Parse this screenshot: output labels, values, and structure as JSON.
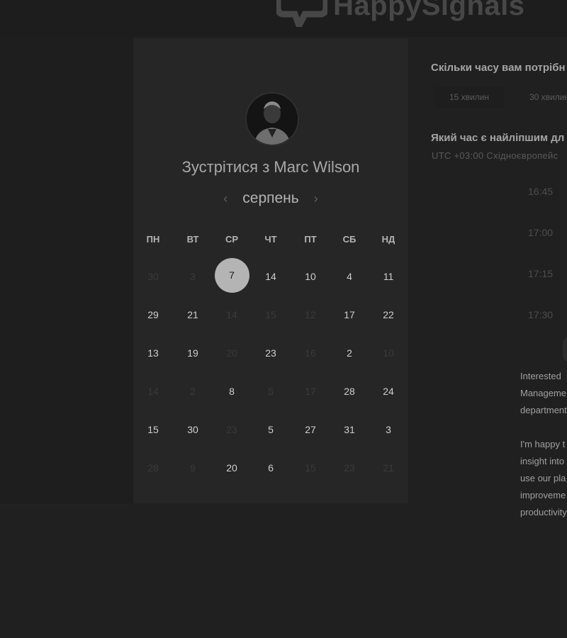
{
  "brand": {
    "name": "HappySignals",
    "logo_icon": "speech-bubble-check-icon"
  },
  "meeting": {
    "title": "Зустрітися з Marc Wilson",
    "avatar": "avatar-photo"
  },
  "calendar": {
    "month": "серпень",
    "prev_icon": "chevron-left-icon",
    "next_icon": "chevron-right-icon",
    "weekdays": [
      "ПН",
      "ВТ",
      "СР",
      "ЧТ",
      "ПТ",
      "СБ",
      "НД"
    ],
    "weeks": [
      [
        "30",
        "3",
        "7",
        "14",
        "10",
        "4",
        "11"
      ],
      [
        "29",
        "21",
        "14",
        "15",
        "12",
        "17",
        "22"
      ],
      [
        "13",
        "19",
        "20",
        "23",
        "16",
        "2",
        "10"
      ],
      [
        "14",
        "2",
        "8",
        "5",
        "17",
        "28",
        "24"
      ],
      [
        "15",
        "30",
        "23",
        "5",
        "27",
        "31",
        "3"
      ],
      [
        "28",
        "9",
        "20",
        "6",
        "15",
        "23",
        "21"
      ]
    ],
    "selected": "7"
  },
  "duration": {
    "question": "Скільки часу вам потрібн",
    "options": [
      "15 хвилин",
      "30 хвилин"
    ]
  },
  "time": {
    "question": "Який час є найліпшим дл",
    "timezone": "UTC +03:00 Східноєвропейс",
    "slots": [
      "16:45",
      "17:00",
      "17:15",
      "17:30"
    ]
  },
  "description": {
    "para1": [
      "Interested",
      "Manageme",
      "department"
    ],
    "para2": [
      "I'm happy t",
      "insight into",
      "use our pla",
      "improveme",
      "productivity"
    ]
  }
}
